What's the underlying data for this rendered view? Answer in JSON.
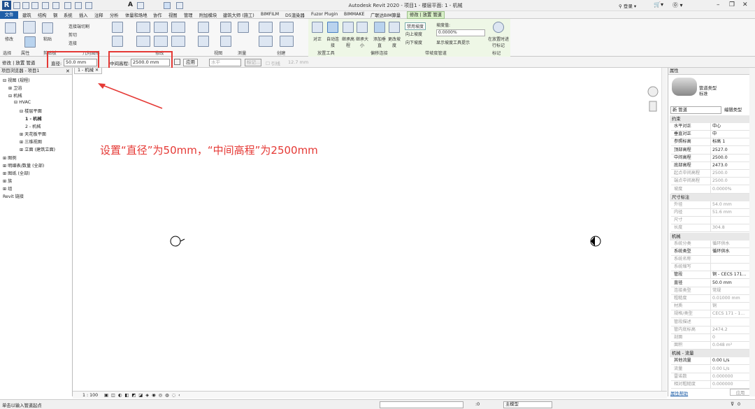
{
  "app": {
    "title": "Autodesk Revit 2020 - 项目1 - 楼层平面: 1 - 机械",
    "login": "登录",
    "help": "?"
  },
  "tabs": [
    "文件",
    "建筑",
    "结构",
    "钢",
    "系统",
    "插入",
    "注释",
    "分析",
    "体量和场地",
    "协作",
    "视图",
    "管理",
    "附加模块",
    "建筑大师 (施工)",
    "BIMFILM",
    "D5渲染器",
    "Fuzor Plugin",
    "BIMMAKE",
    "广联达BIM算量",
    "修改 | 放置 管道"
  ],
  "ribbon": {
    "buttons": {
      "modify": "修改",
      "paste": "粘贴",
      "cope": "连接端切割",
      "cut": "剪切",
      "join": "连接",
      "align": "对正",
      "auto_connect": "自动连接",
      "inherit_elev": "继承高程",
      "inherit_size": "继承大小",
      "add_vertical": "添加垂直",
      "change_slope": "更改坡度",
      "disable_slope": "禁用坡度",
      "slope_up": "向上坡度",
      "slope_down": "向下坡度",
      "slope_value_label": "坡度值:",
      "slope_value": "0.0000%",
      "show_slope_tooltip": "显示坡度工具提示",
      "tag_on_place": "在放置时进行标记"
    },
    "panels": [
      "选择",
      "属性",
      "剪贴板",
      "几何图形",
      "修改",
      "视图",
      "测量",
      "创建",
      "放置工具",
      "偏移连接",
      "带坡度管道",
      "标记"
    ]
  },
  "options": {
    "context": "修改 | 放置 管道",
    "diameter_label": "直径:",
    "diameter_value": "50.0 mm",
    "middle_elev_label": "中间高程:",
    "middle_elev_value": "2500.0 mm",
    "apply": "应用",
    "horizontal": "水平",
    "tag": "标记...",
    "lead": "引线",
    "lead_len": "12.7 mm"
  },
  "view_tab": "1 - 机械",
  "browser": {
    "title": "项目浏览器 - 项目1",
    "nodes": [
      {
        "label": "视图 (规程)"
      },
      {
        "label": "卫浴"
      },
      {
        "label": "机械"
      },
      {
        "label": "HVAC"
      },
      {
        "label": "楼层平面"
      },
      {
        "label": "1 - 机械"
      },
      {
        "label": "2 - 机械"
      },
      {
        "label": "天花板平面"
      },
      {
        "label": "三维视图"
      },
      {
        "label": "立面 (建筑立面)"
      },
      {
        "label": "图例"
      },
      {
        "label": "明细表/数量 (全部)"
      },
      {
        "label": "图纸 (全部)"
      },
      {
        "label": "族"
      },
      {
        "label": "组"
      },
      {
        "label": "Revit 链接"
      }
    ]
  },
  "annotation": "设置“直径”为50mm，“中间高程”为2500mm",
  "properties": {
    "header": "属性",
    "type_name": "管道类型",
    "type_sub": "标准",
    "selector": "新 管道",
    "edit_type": "编辑类型",
    "sections": [
      {
        "name": "约束",
        "rows": [
          {
            "k": "水平对正",
            "v": "中心"
          },
          {
            "k": "垂直对正",
            "v": "中"
          },
          {
            "k": "参照标高",
            "v": "标高 1"
          },
          {
            "k": "顶部高程",
            "v": "2527.0"
          },
          {
            "k": "中间高程",
            "v": "2500.0"
          },
          {
            "k": "底部高程",
            "v": "2473.0"
          },
          {
            "k": "起点中间高程",
            "v": "2500.0",
            "gray": true
          },
          {
            "k": "端点中间高程",
            "v": "2500.0",
            "gray": true
          },
          {
            "k": "坡度",
            "v": "0.0000%",
            "gray": true
          }
        ]
      },
      {
        "name": "尺寸标注",
        "rows": [
          {
            "k": "外径",
            "v": "54.0 mm",
            "gray": true
          },
          {
            "k": "内径",
            "v": "51.6 mm",
            "gray": true
          },
          {
            "k": "尺寸",
            "v": "",
            "gray": true
          },
          {
            "k": "长度",
            "v": "304.8",
            "gray": true
          }
        ]
      },
      {
        "name": "机械",
        "rows": [
          {
            "k": "系统分类",
            "v": "循环供水",
            "gray": true
          },
          {
            "k": "系统类型",
            "v": "循环供水"
          },
          {
            "k": "系统名称",
            "v": "",
            "gray": true
          },
          {
            "k": "系统缩写",
            "v": "",
            "gray": true
          },
          {
            "k": "管段",
            "v": "铜 - CECS 171..."
          },
          {
            "k": "直径",
            "v": "50.0 mm"
          },
          {
            "k": "连接类型",
            "v": "常规",
            "gray": true
          },
          {
            "k": "粗糙度",
            "v": "0.01000 mm",
            "gray": true
          },
          {
            "k": "材质",
            "v": "铜",
            "gray": true
          },
          {
            "k": "规格/类型",
            "v": "CECS 171 - 1...",
            "gray": true
          },
          {
            "k": "管段描述",
            "v": "",
            "gray": true
          },
          {
            "k": "管内底标高",
            "v": "2474.2",
            "gray": true
          },
          {
            "k": "剖面",
            "v": "0",
            "gray": true
          },
          {
            "k": "面积",
            "v": "0.048 m²",
            "gray": true
          }
        ]
      },
      {
        "name": "机械 - 流量",
        "rows": [
          {
            "k": "其他流量",
            "v": "0.00 L/s"
          },
          {
            "k": "流量",
            "v": "0.00 L/s",
            "gray": true
          },
          {
            "k": "雷诺数",
            "v": "0.000000",
            "gray": true
          },
          {
            "k": "相对粗糙度",
            "v": "0.000000",
            "gray": true
          }
        ]
      }
    ],
    "help": "属性帮助",
    "apply": "应用"
  },
  "viewbar": {
    "scale": "1 : 100"
  },
  "status": {
    "hint": "单击以输入管道起点",
    "zero": ":0",
    "model": "主模型",
    "filter": "0"
  },
  "colors": {
    "accent": "#1f5fa8",
    "red": "#e53935",
    "context_tab": "#d9f0c8"
  }
}
